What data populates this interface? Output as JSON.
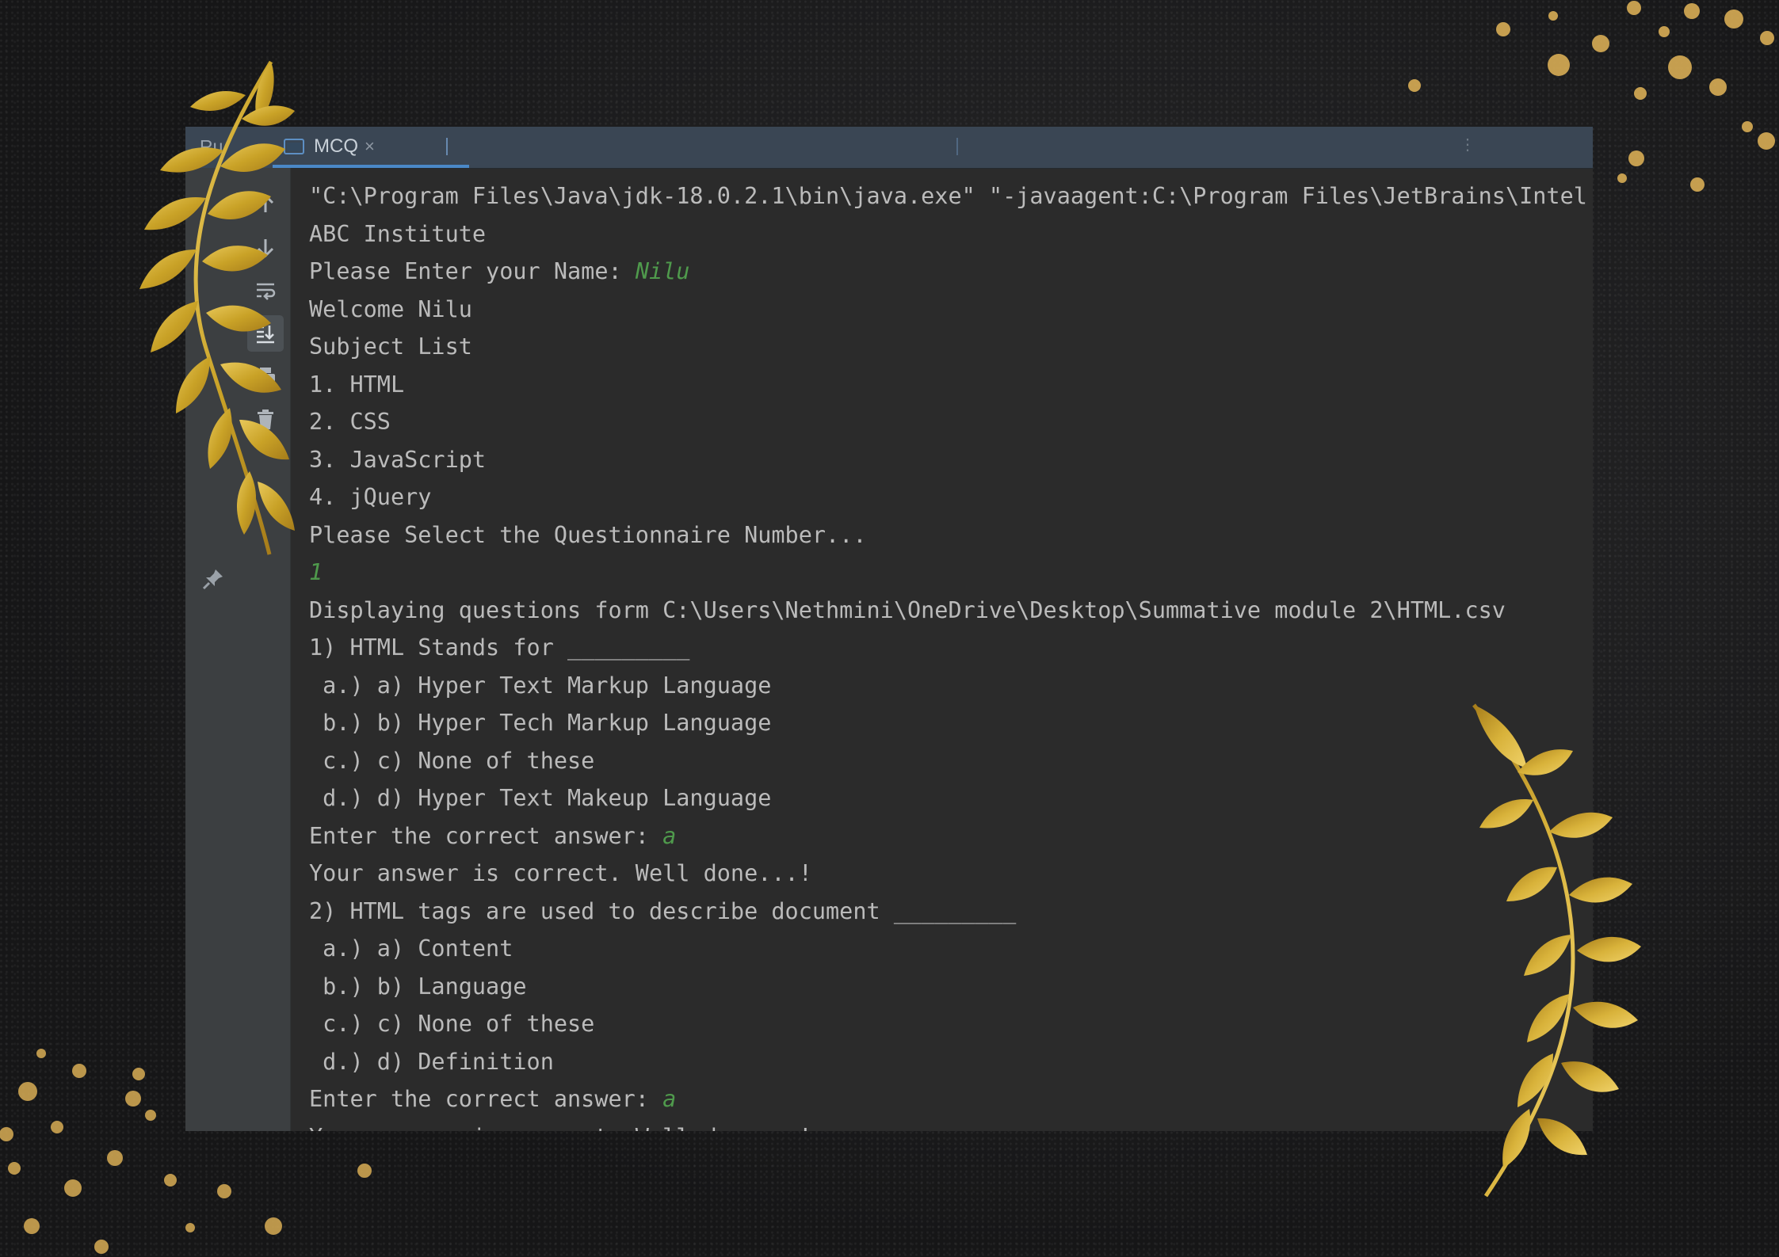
{
  "window": {
    "run_tab_label": "Ru",
    "tab": {
      "label": "MCQ",
      "close": "×"
    },
    "more_icon": "⋮"
  },
  "toolbar": {
    "items": [
      "arrow-up-icon",
      "arrow-down-icon",
      "soft-wrap-icon",
      "scroll-to-end-icon",
      "print-icon",
      "trash-icon"
    ],
    "active": "scroll-to-end-icon"
  },
  "console": {
    "lines": [
      {
        "text": "\"C:\\Program Files\\Java\\jdk-18.0.2.1\\bin\\java.exe\" \"-javaagent:C:\\Program Files\\JetBrains\\Intel"
      },
      {
        "text": "ABC Institute"
      },
      {
        "text": "Please Enter your Name: ",
        "input": "Nilu"
      },
      {
        "text": "Welcome Nilu"
      },
      {
        "text": "Subject List"
      },
      {
        "text": "1. HTML"
      },
      {
        "text": "2. CSS"
      },
      {
        "text": "3. JavaScript"
      },
      {
        "text": "4. jQuery"
      },
      {
        "text": "Please Select the Questionnaire Number..."
      },
      {
        "text": "",
        "input": "1"
      },
      {
        "text": "Displaying questions form C:\\Users\\Nethmini\\OneDrive\\Desktop\\Summative module 2\\HTML.csv"
      },
      {
        "text": "1) HTML Stands for _________"
      },
      {
        "text": " a.) a) Hyper Text Markup Language"
      },
      {
        "text": " b.) b) Hyper Tech Markup Language"
      },
      {
        "text": " c.) c) None of these"
      },
      {
        "text": " d.) d) Hyper Text Makeup Language"
      },
      {
        "text": "Enter the correct answer: ",
        "input": "a"
      },
      {
        "text": "Your answer is correct. Well done...!"
      },
      {
        "text": "2) HTML tags are used to describe document _________"
      },
      {
        "text": " a.) a) Content"
      },
      {
        "text": " b.) b) Language"
      },
      {
        "text": " c.) c) None of these"
      },
      {
        "text": " d.) d) Definition"
      },
      {
        "text": "Enter the correct answer: ",
        "input": "a"
      },
      {
        "text": "Your answer is correct. Well done...!"
      }
    ]
  },
  "colors": {
    "console_text": "#bbbbbb",
    "user_input": "#4f9a4c",
    "tab_underline": "#4a88c7",
    "leaf_gold": "#c9a227",
    "dot_gold": "#d4a84a"
  }
}
